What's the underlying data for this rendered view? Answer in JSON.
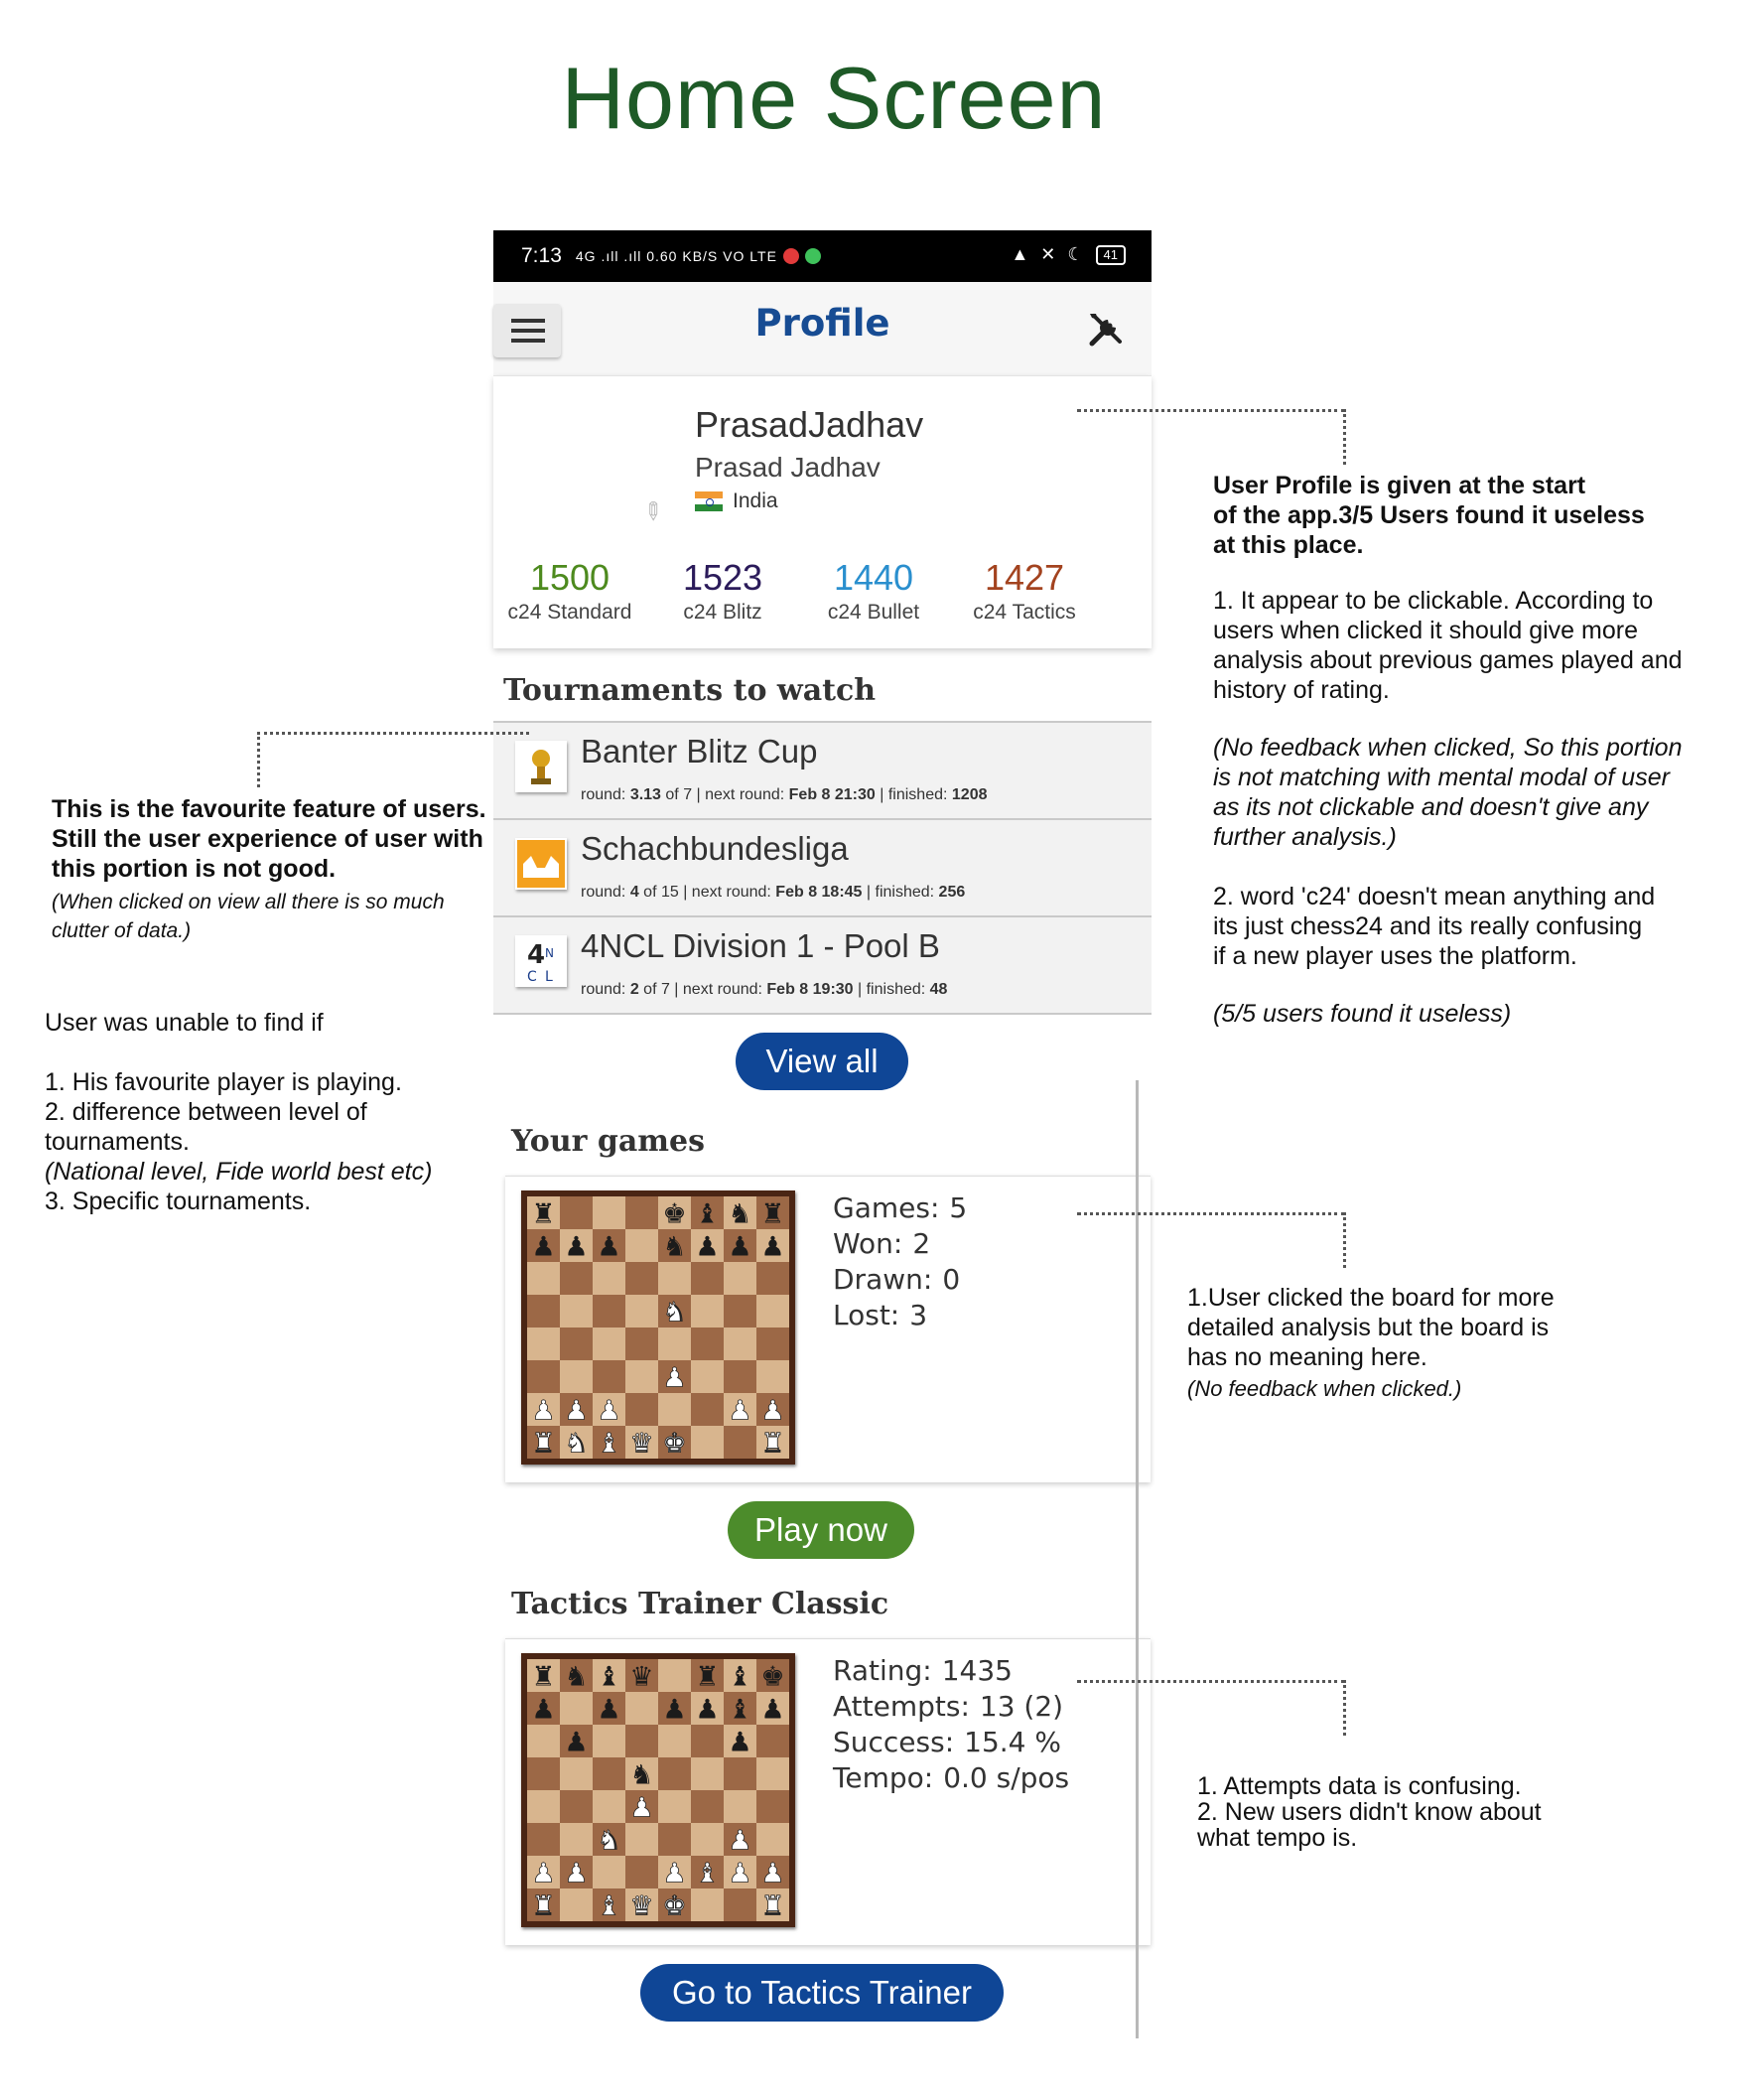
{
  "page_title": "Home Screen",
  "status_bar": {
    "time": "7:13",
    "signal_text": "4G .ıll .ıll 0.60 KB/S VO LTE",
    "battery": "41"
  },
  "app_bar": {
    "title": "Profile",
    "menu_icon": "hamburger-menu-icon",
    "tools_icon": "tools-icon"
  },
  "profile": {
    "username": "PrasadJadhav",
    "real_name": "Prasad Jadhav",
    "country": "India",
    "ratings": [
      {
        "value": "1500",
        "label": "c24 Standard",
        "color": "#4d8a1e"
      },
      {
        "value": "1523",
        "label": "c24 Blitz",
        "color": "#2b1b5a"
      },
      {
        "value": "1440",
        "label": "c24 Bullet",
        "color": "#2a8fce"
      },
      {
        "value": "1427",
        "label": "c24 Tactics",
        "color": "#a3431f"
      }
    ]
  },
  "tournaments": {
    "heading": "Tournaments to watch",
    "items": [
      {
        "name": "Banter Blitz Cup",
        "meta": [
          "round: ",
          "3.13",
          " of 7 | next round: ",
          "Feb 8 21:30",
          " | finished: ",
          "1208"
        ]
      },
      {
        "name": "Schachbundesliga",
        "meta": [
          "round: ",
          "4",
          " of 15 | next round: ",
          "Feb 8 18:45",
          " | finished: ",
          "256"
        ]
      },
      {
        "name": "4NCL Division 1 - Pool B",
        "meta": [
          "round: ",
          "2",
          " of 7 | next round: ",
          "Feb 8 19:30",
          " | finished: ",
          "48"
        ]
      }
    ],
    "view_all": "View all"
  },
  "your_games": {
    "heading": "Your games",
    "stats": [
      {
        "label": "Games:",
        "value": "5"
      },
      {
        "label": "Won:",
        "value": "2"
      },
      {
        "label": "Drawn:",
        "value": "0"
      },
      {
        "label": "Lost:",
        "value": "3"
      }
    ],
    "play_now": "Play now"
  },
  "tactics": {
    "heading": "Tactics Trainer Classic",
    "stats": [
      {
        "label": "Rating:",
        "value": "1435"
      },
      {
        "label": "Attempts:",
        "value": "13 (2)"
      },
      {
        "label": "Success:",
        "value": "15.4 %"
      },
      {
        "label": "Tempo:",
        "value": "0.0 s/pos"
      }
    ],
    "button": "Go to Tactics Trainer"
  },
  "annotations": {
    "profile": {
      "intro": [
        "User Profile is given at the start",
        "of the app.3/5 Users found it useless",
        "at this place."
      ],
      "p1": [
        "1. It appear to be clickable. According to",
        "users when clicked it should give more",
        "analysis about previous games played and",
        "history of rating."
      ],
      "p1_note": [
        "(No feedback when clicked, So this portion",
        "is not matching with mental modal of user",
        "as its not clickable and doesn't give any",
        "further analysis.)"
      ],
      "p2": [
        "2. word 'c24' doesn't mean anything and",
        "its just chess24 and its really confusing",
        "if a new player uses the platform."
      ],
      "p2_note": "(5/5 users found it useless)"
    },
    "tournaments": {
      "intro": [
        "This is the favourite feature of users.",
        "Still the user experience of user with",
        "this portion is not good."
      ],
      "note": [
        "(When clicked on view all there is so much",
        "clutter of data.)"
      ],
      "find_head": "User was unable to find if",
      "list": [
        "1. His favourite player is playing.",
        "2. difference between level of",
        "tournaments."
      ],
      "list_note": "(National level, Fide world best etc)",
      "list_3": "3. Specific tournaments."
    },
    "games": {
      "text": [
        "1.User clicked the board for more",
        "detailed analysis but the board is",
        "has no meaning here."
      ],
      "note": "(No feedback when clicked.)"
    },
    "tactics": {
      "text": [
        "1. Attempts data is confusing.",
        "2. New users didn't know about",
        "what tempo is."
      ]
    }
  },
  "colors": {
    "title_green": "#1e5a27",
    "profile_blue": "#174c93",
    "view_all_blue": "#0f4696",
    "play_green": "#4c8c2b"
  },
  "boards": {
    "games": [
      "r...kbnr",
      "ppp.nppp",
      "........",
      "....N...",
      "........",
      "....P...",
      "PPP...PP",
      "RNBQK..R"
    ],
    "tactics": [
      "rnbq.rbk",
      "p.p.ppbp",
      ".p....p.",
      "...n....",
      "...P....",
      "..N...P.",
      "PP..PBPP",
      "R.BQK..R"
    ]
  }
}
